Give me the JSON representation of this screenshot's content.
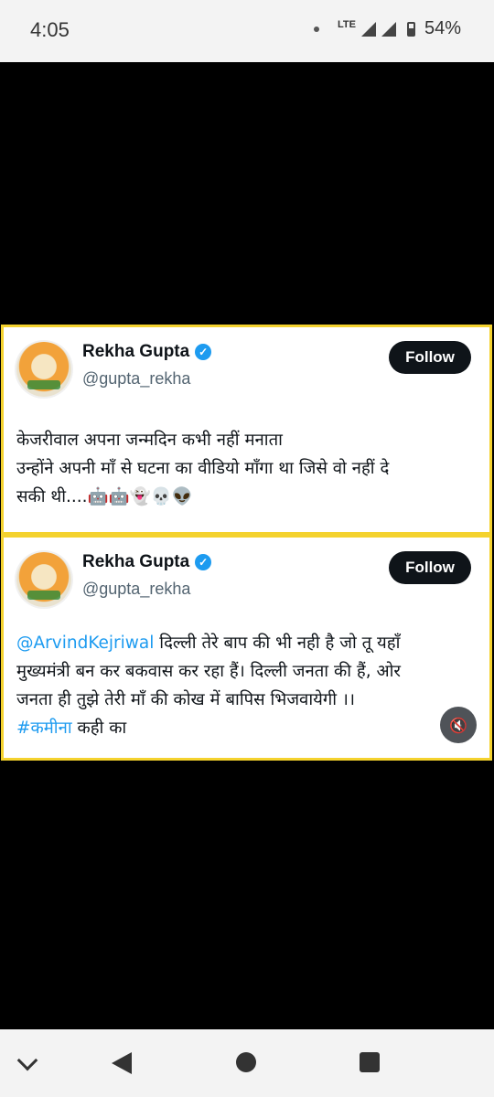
{
  "status_bar": {
    "time": "4:05",
    "network": "LTE",
    "battery": "54%"
  },
  "tweets": [
    {
      "name": "Rekha Gupta",
      "handle": "@gupta_rekha",
      "follow_label": "Follow",
      "text_line1": "केजरीवाल अपना जन्मदिन कभी नहीं मनाता",
      "text_line2": "उन्होंने अपनी माँ से घटना का वीडियो माँगा था जिसे वो नहीं दे",
      "text_line3": "सकी थी....",
      "emojis": "🤖🤖👻💀👽"
    },
    {
      "name": "Rekha Gupta",
      "handle": "@gupta_rekha",
      "follow_label": "Follow",
      "mention": "@ArvindKejriwal",
      "text_line1": " दिल्ली तेरे बाप की भी नही है जो तू यहाँ",
      "text_line2": "मुख्यमंत्री बन कर बकवास कर रहा हैं। दिल्ली जनता की हैं, ओर",
      "text_line3": "जनता ही तुझे तेरी माँ की कोख में बापिस भिजवायेगी ।।",
      "hashtag": "#कमीना",
      "text_line4": " कही का",
      "mute_icon": "🔇"
    }
  ],
  "navigation": {
    "icons": [
      "chevron-down-icon",
      "back-icon",
      "home-icon",
      "recents-icon"
    ]
  }
}
